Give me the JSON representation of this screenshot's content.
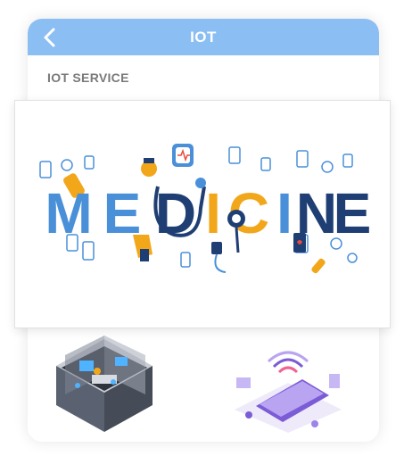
{
  "header": {
    "title": "IOT",
    "back_icon": "chevron-left-icon",
    "color": "#8bbef2"
  },
  "section": {
    "title": "IOT SERVICE"
  },
  "banner": {
    "letters": [
      "M",
      "E",
      "D",
      "I",
      "C",
      "I",
      "N",
      "E"
    ],
    "letter_colors": [
      "#4a90d9",
      "#4a90d9",
      "#1f3f74",
      "#f2a71b",
      "#f2a71b",
      "#4a90d9",
      "#1f3f74",
      "#1f3f74"
    ]
  },
  "thumbnails": [
    {
      "icon": "isometric-room-icon"
    },
    {
      "icon": "smartphone-wireless-icon"
    }
  ]
}
